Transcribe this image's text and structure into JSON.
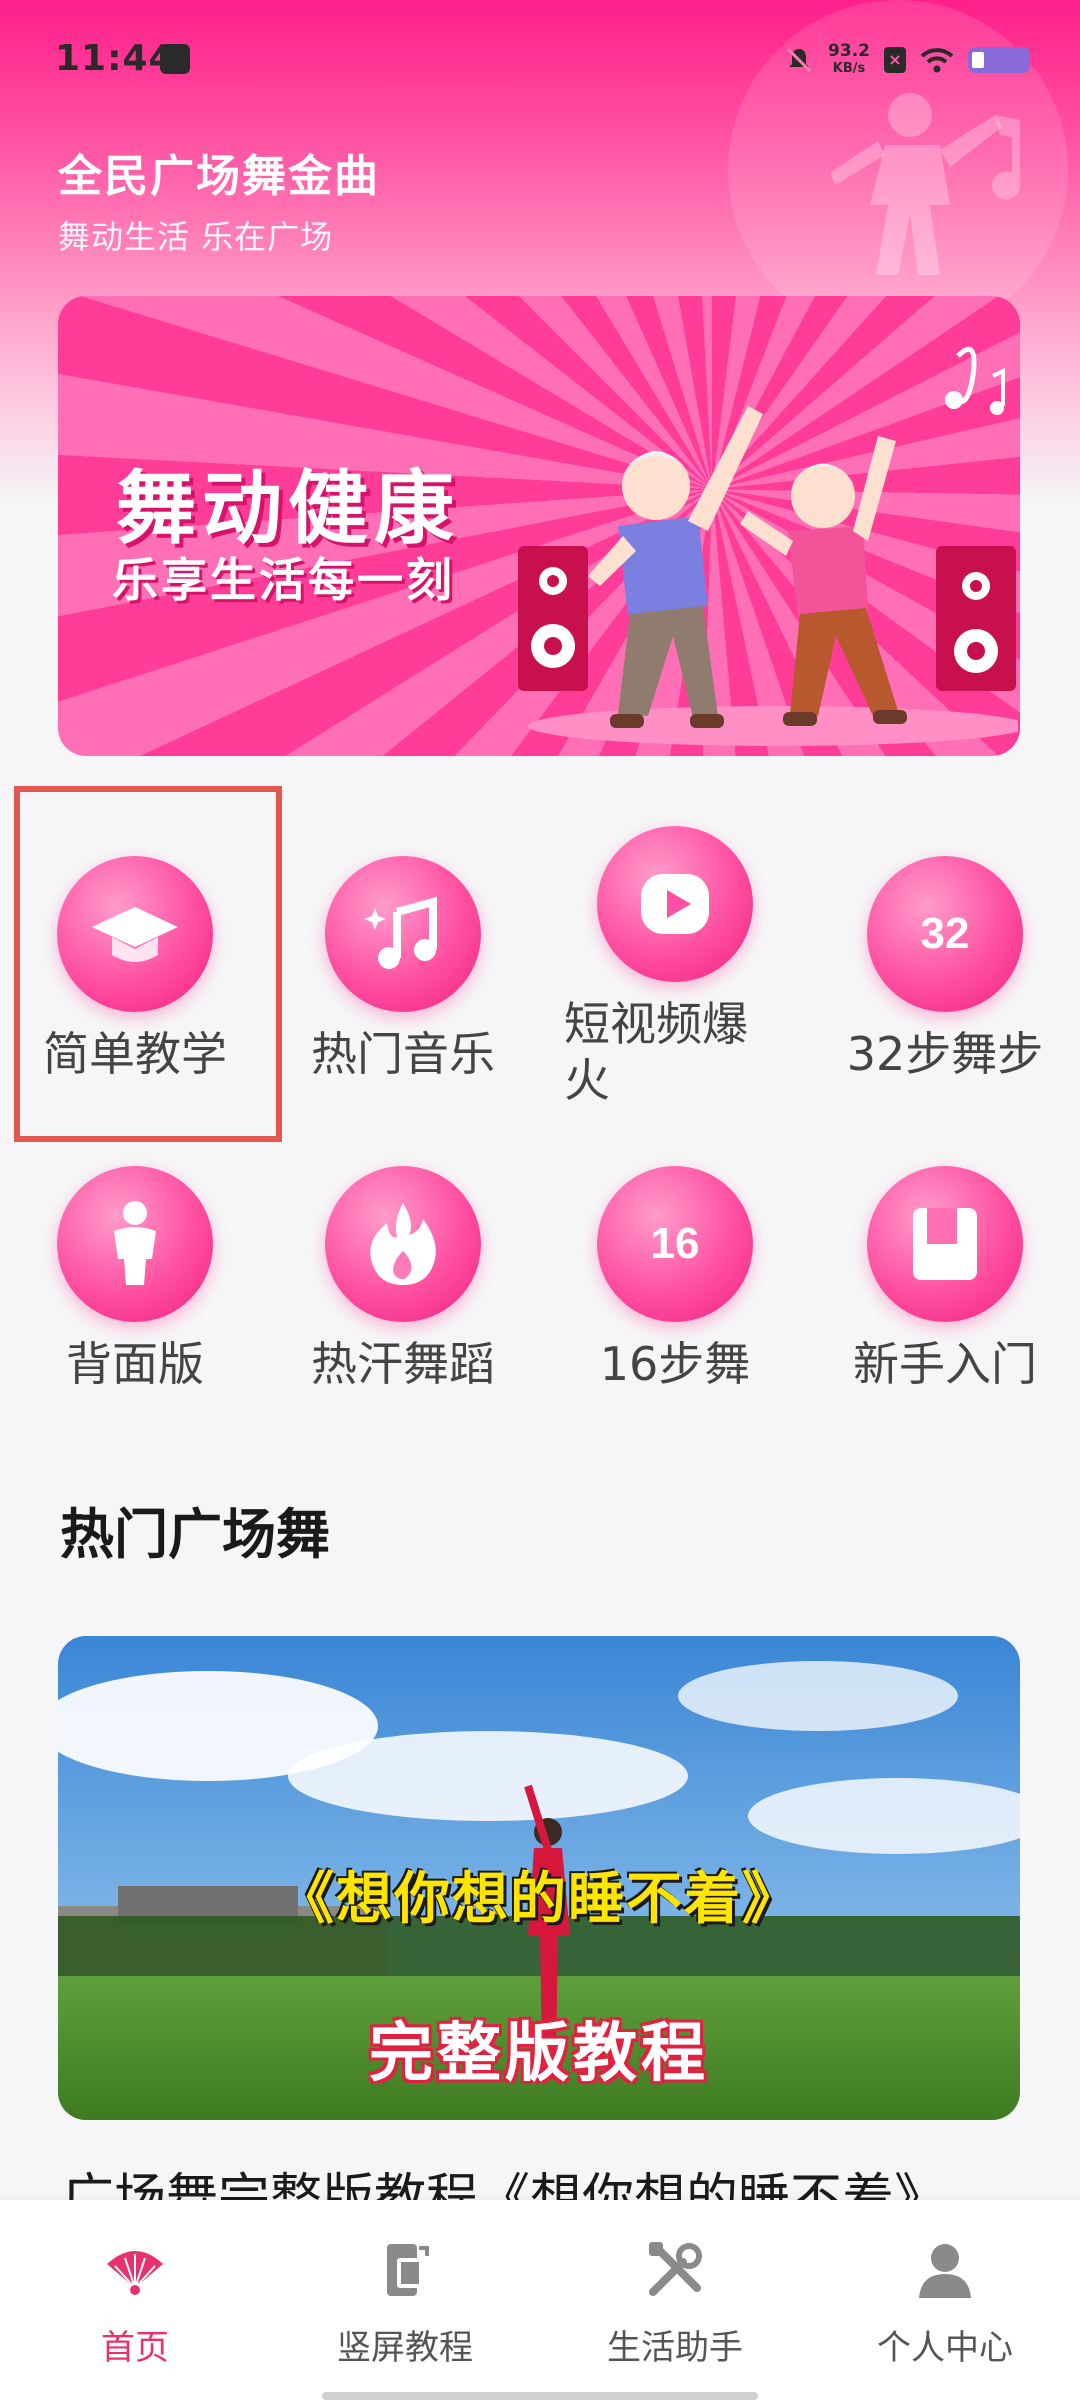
{
  "status_bar": {
    "time": "11:44",
    "net_speed_value": "93.2",
    "net_speed_unit": "KB/s"
  },
  "header": {
    "title": "全民广场舞金曲",
    "subtitle": "舞动生活 乐在广场"
  },
  "banner": {
    "headline": "舞动健康",
    "subline": "乐享生活每一刻"
  },
  "categories": [
    {
      "label": "简单教学",
      "icon": "graduation-cap-icon"
    },
    {
      "label": "热门音乐",
      "icon": "music-note-icon"
    },
    {
      "label": "短视频爆火",
      "icon": "play-icon"
    },
    {
      "label": "32步舞步",
      "icon": "number-32-icon"
    },
    {
      "label": "背面版",
      "icon": "person-back-icon"
    },
    {
      "label": "热汗舞蹈",
      "icon": "flame-icon"
    },
    {
      "label": "16步舞",
      "icon": "number-16-icon"
    },
    {
      "label": "新手入门",
      "icon": "book-icon"
    }
  ],
  "section": {
    "title": "热门广场舞"
  },
  "featured_video": {
    "overlay_title": "《想你想的睡不着》",
    "overlay_subtitle": "完整版教程",
    "caption": "广场舞完整版教程《想你想的睡不着》"
  },
  "bottom_nav": [
    {
      "label": "首页",
      "icon": "fan-icon",
      "active": true
    },
    {
      "label": "竖屏教程",
      "icon": "vertical-screen-icon",
      "active": false
    },
    {
      "label": "生活助手",
      "icon": "tools-icon",
      "active": false
    },
    {
      "label": "个人中心",
      "icon": "user-icon",
      "active": false
    }
  ],
  "colors": {
    "brand": "#ff2e8c",
    "active_nav": "#e8326f",
    "highlight_border": "#e2584f"
  },
  "cat_icon_text": {
    "c32": "32",
    "c16": "16"
  }
}
